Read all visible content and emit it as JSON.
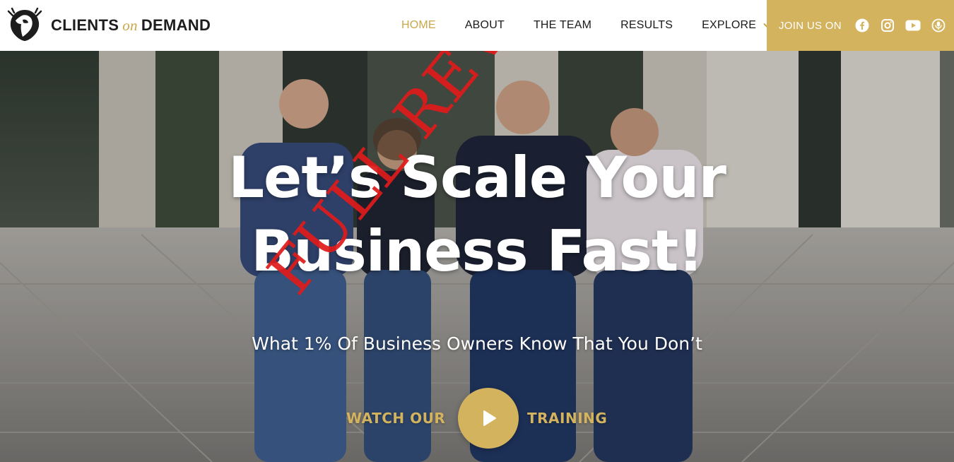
{
  "brand": {
    "name_left": "CLIENTS",
    "name_mid": "on",
    "name_right": "DEMAND",
    "accent_color": "#d4b35f"
  },
  "nav": {
    "items": [
      {
        "label": "HOME",
        "active": true
      },
      {
        "label": "ABOUT",
        "active": false
      },
      {
        "label": "THE TEAM",
        "active": false
      },
      {
        "label": "RESULTS",
        "active": false
      },
      {
        "label": "EXPLORE",
        "active": false,
        "dropdown": true
      }
    ]
  },
  "join": {
    "label": "JOIN US ON",
    "icons": [
      "facebook-icon",
      "instagram-icon",
      "youtube-icon",
      "podcast-icon"
    ]
  },
  "hero": {
    "headline_line1": "Let’s Scale Your",
    "headline_line2": "Business Fast!",
    "subheadline": "What 1% Of Business Owners Know That You Don’t",
    "cta_left": "WATCH OUR",
    "cta_right": "TRAINING"
  },
  "stamp": {
    "text": "FULL REVIEW",
    "color": "#e01b1b"
  }
}
